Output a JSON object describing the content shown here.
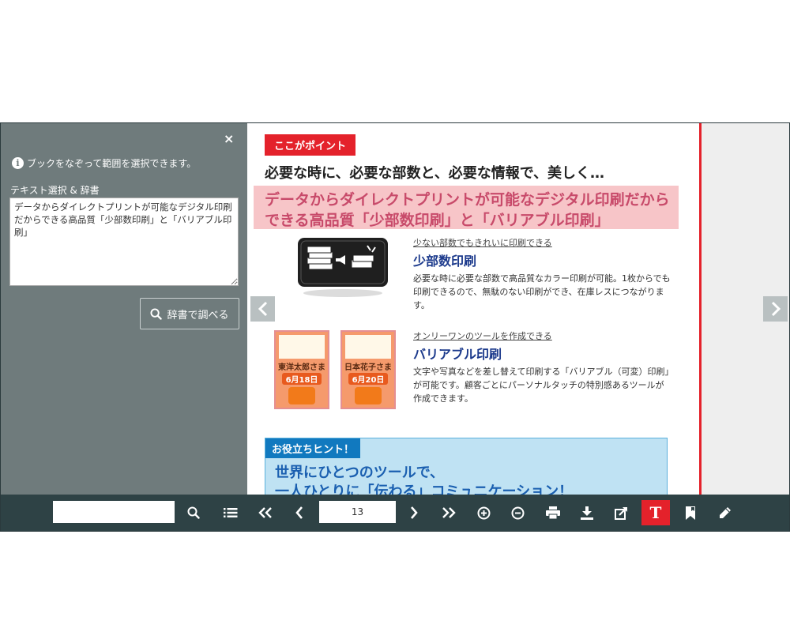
{
  "sidebar": {
    "close_glyph": "×",
    "info_glyph": "i",
    "info_text": "ブックをなぞって範囲を選択できます。",
    "section_label": "テキスト選択 & 辞書",
    "selected_text": "データからダイレクトプリントが可能なデジタル印刷だからできる高品質「少部数印刷」と「バリアブル印刷」",
    "dict_button": "辞書で調べる"
  },
  "page": {
    "tag": "ここがポイント",
    "headline": "必要な時に、必要な部数と、必要な情報で、美しく…",
    "highlight_line1": "データからダイレクトプリントが可能なデジタル印刷だから",
    "highlight_line2": "できる高品質「少部数印刷」と「バリアブル印刷」",
    "feature1": {
      "sub": "少ない部数でもきれいに印刷できる",
      "title": "少部数印刷",
      "desc": "必要な時に必要な部数で高品質なカラー印刷が可能。1枚からでも印刷できるので、無駄のない印刷ができ、在庫レスにつながります。"
    },
    "feature2": {
      "sub": "オンリーワンのツールを作成できる",
      "title": "バリアブル印刷",
      "desc": "文字や写真などを差し替えて印刷する「バリアブル（可変）印刷」が可能です。顧客ごとにパーソナルタッチの特別感あるツールが作成できます。"
    },
    "cards": [
      {
        "name": "東洋太郎さま",
        "date": "6月18日"
      },
      {
        "name": "日本花子さま",
        "date": "6月20日"
      }
    ],
    "hint": {
      "label": "お役立ちヒント！",
      "line1": "世界にひとつのツールで、",
      "line2": "一人ひとりに「伝わる」コミュニケーション！"
    }
  },
  "toolbar": {
    "search_value": "",
    "page_number": "13",
    "text_tool_glyph": "T"
  },
  "colors": {
    "accent_red": "#e4222b",
    "toolbar_bg": "#2e4245",
    "sidebar_bg": "#6f7b7c",
    "title_blue": "#1c3a8c"
  }
}
